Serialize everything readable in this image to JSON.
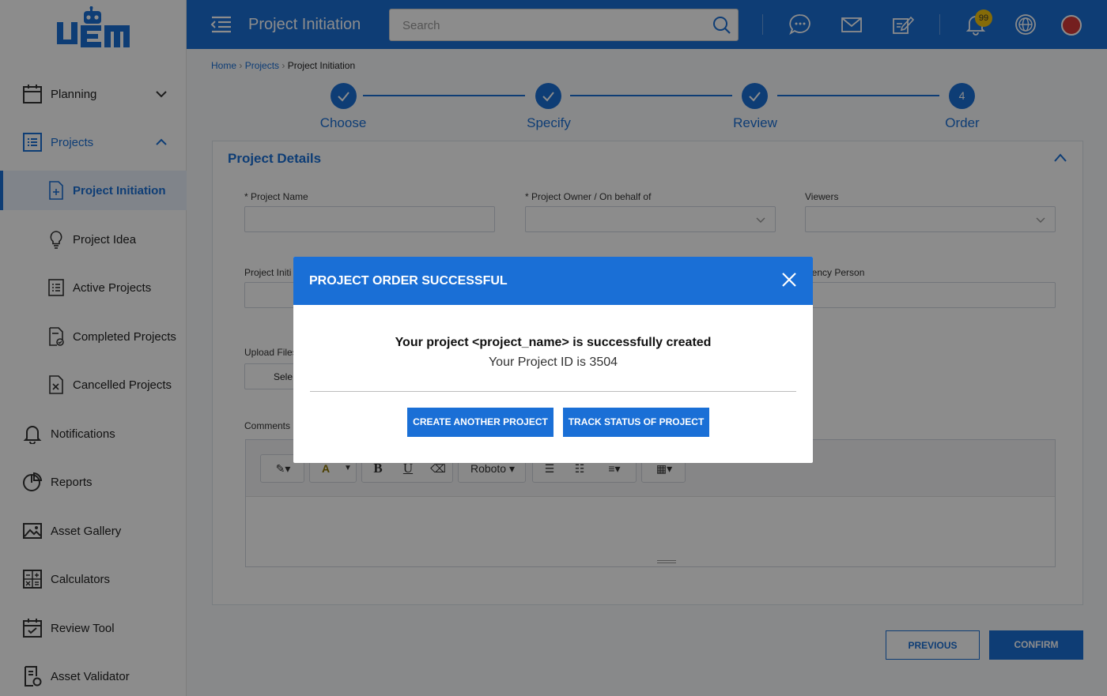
{
  "app": {
    "logo_text": "VEM"
  },
  "header": {
    "title": "Project Initiation",
    "search_placeholder": "Search",
    "notification_count": "99",
    "icons": [
      "menu-icon",
      "chat-icon",
      "mail-icon",
      "edit-icon",
      "bell-icon",
      "globe-icon",
      "avatar"
    ]
  },
  "sidebar": {
    "items": [
      {
        "label": "Planning",
        "icon": "calendar-icon"
      },
      {
        "label": "Projects",
        "icon": "list-icon"
      },
      {
        "label": "Project Initiation",
        "icon": "file-plus-icon"
      },
      {
        "label": "Project Idea",
        "icon": "lightbulb-icon"
      },
      {
        "label": "Active Projects",
        "icon": "list-icon"
      },
      {
        "label": "Completed Projects",
        "icon": "file-check-icon"
      },
      {
        "label": "Cancelled Projects",
        "icon": "file-x-icon"
      },
      {
        "label": "Notifications",
        "icon": "bell-icon"
      },
      {
        "label": "Reports",
        "icon": "pie-chart-icon"
      },
      {
        "label": "Asset Gallery",
        "icon": "image-icon"
      },
      {
        "label": "Calculators",
        "icon": "calculator-icon"
      },
      {
        "label": "Review Tool",
        "icon": "calendar-check-icon"
      },
      {
        "label": "Asset Validator",
        "icon": "document-check-icon"
      }
    ]
  },
  "breadcrumb": {
    "home": "Home",
    "projects": "Projects",
    "current": "Project Initiation"
  },
  "stepper": {
    "steps": [
      {
        "label": "Choose",
        "state": "done"
      },
      {
        "label": "Specify",
        "state": "done"
      },
      {
        "label": "Review",
        "state": "done"
      },
      {
        "label": "Order",
        "state": "current",
        "number": "4"
      }
    ]
  },
  "form": {
    "section_title": "Project Details",
    "project_name_label": "* Project Name",
    "project_owner_label": "* Project Owner / On behalf of",
    "viewers_label": "Viewers",
    "project_initiation_label_partial": "Project Initi",
    "agency_person_label_partial": "gency Person",
    "upload_files_label_partial": "Upload Files",
    "select_button_partial": "Sele",
    "comments_label_partial": "Comments",
    "editor": {
      "font": "Roboto",
      "toolbar": [
        "magic-icon",
        "text-color-icon",
        "bold-icon",
        "underline-icon",
        "eraser-icon",
        "font-select",
        "bullet-list-icon",
        "numbered-list-icon",
        "align-icon",
        "table-icon"
      ]
    }
  },
  "footer": {
    "previous": "PREVIOUS",
    "confirm": "CONFIRM"
  },
  "modal": {
    "title": "PROJECT ORDER SUCCESSFUL",
    "message": "Your project <project_name> is successfully created",
    "project_id_text": "Your Project ID is 3504",
    "create_button": "CREATE ANOTHER PROJECT",
    "track_button": "TRACK STATUS OF PROJECT"
  },
  "colors": {
    "primary": "#1a6fd6",
    "badge": "#f2c40f",
    "overlay": "rgba(0,0,0,0.45)"
  }
}
